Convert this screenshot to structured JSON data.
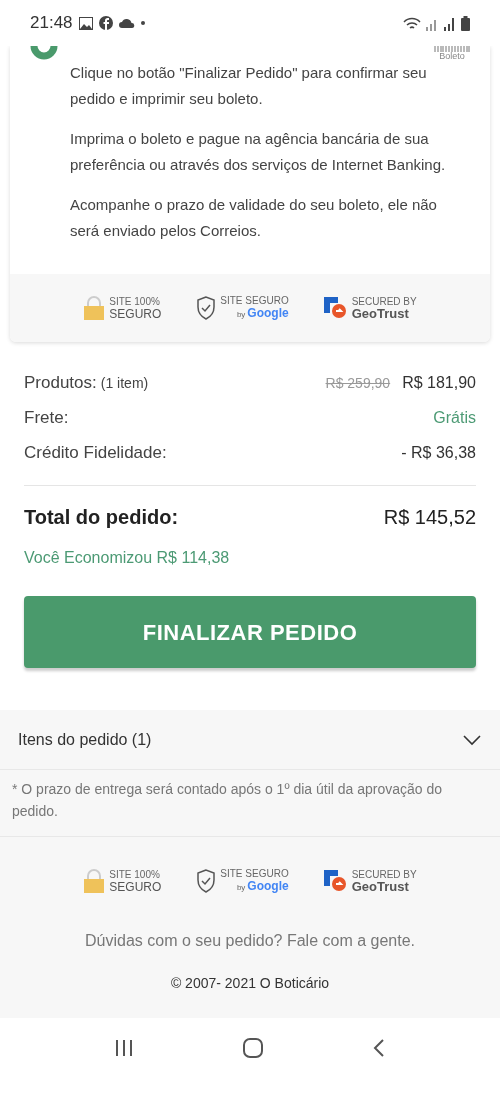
{
  "status_bar": {
    "time": "21:48"
  },
  "payment": {
    "selected": true,
    "badge": "Boleto",
    "paragraphs": [
      "Clique no botão \"Finalizar Pedido\" para confirmar seu pedido e imprimir seu boleto.",
      "Imprima o boleto e pague na agência bancária de sua preferência ou através dos serviços de Internet Banking.",
      "Acompanhe o prazo de validade do seu boleto, ele não será enviado pelos Correios."
    ]
  },
  "seals_top": [
    {
      "kind": "lock",
      "line1": "SITE 100%",
      "line2": "SEGURO"
    },
    {
      "kind": "google",
      "line1": "SITE SEGURO",
      "line2a": "by",
      "line2": "Google"
    },
    {
      "kind": "geotrust",
      "line1": "SECURED BY",
      "line2": "GeoTrust"
    }
  ],
  "summary": {
    "rows": [
      {
        "label": "Produtos:",
        "note": "(1 item)",
        "old_value": "R$ 259,90",
        "value": "R$ 181,90"
      },
      {
        "label": "Frete:",
        "value": "Grátis",
        "kind": "green"
      },
      {
        "label": "Crédito Fidelidade:",
        "value": "- R$ 36,38"
      }
    ],
    "total_label": "Total do pedido:",
    "total_value": "R$ 145,52",
    "savings": "Você Economizou R$ 114,38",
    "button": "FINALIZAR PEDIDO"
  },
  "items_panel": {
    "label": "Itens do pedido (1)",
    "expanded": false
  },
  "delivery_note": "* O prazo de entrega será contado após o 1º dia útil da aprovação do pedido.",
  "seals_bottom": [
    {
      "kind": "lock",
      "line1": "SITE 100%",
      "line2": "SEGURO"
    },
    {
      "kind": "google",
      "line1": "SITE SEGURO",
      "line2a": "by",
      "line2": "Google"
    },
    {
      "kind": "geotrust",
      "line1": "SECURED BY",
      "line2": "GeoTrust"
    }
  ],
  "help_text": "Dúvidas com o seu pedido? Fale com a gente.",
  "copyright": "© 2007- 2021 O Boticário"
}
